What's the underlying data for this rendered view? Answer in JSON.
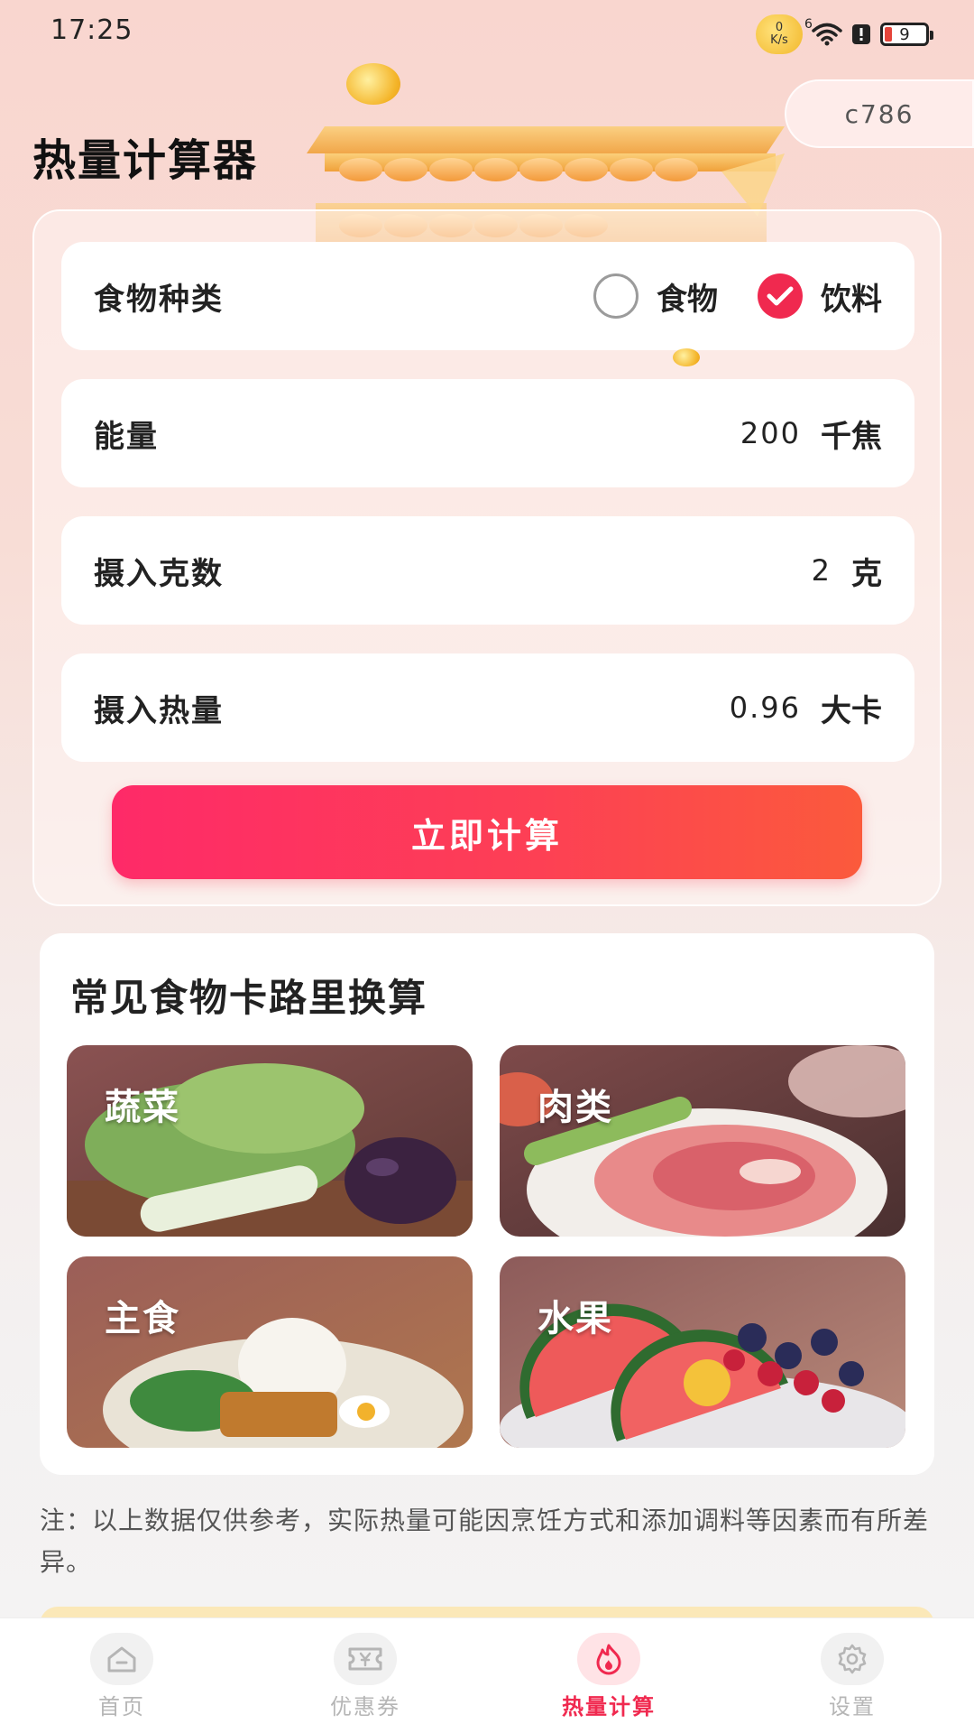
{
  "status_bar": {
    "time": "17:25",
    "net_speed_value": "0",
    "net_speed_unit": "K/s",
    "signal_label": "6",
    "battery_level": "9"
  },
  "header": {
    "title": "热量计算器",
    "user_tag": "c786"
  },
  "calculator": {
    "food_type": {
      "label": "食物种类",
      "options": [
        {
          "label": "食物",
          "checked": false
        },
        {
          "label": "饮料",
          "checked": true
        }
      ]
    },
    "energy": {
      "label": "能量",
      "value": "200",
      "unit": "千焦"
    },
    "grams": {
      "label": "摄入克数",
      "value": "2",
      "unit": "克"
    },
    "calories": {
      "label": "摄入热量",
      "value": "0.96",
      "unit": "大卡"
    },
    "button_label": "立即计算"
  },
  "common_foods": {
    "title": "常见食物卡路里换算",
    "items": [
      {
        "label": "蔬菜",
        "icon": "vegetables-image"
      },
      {
        "label": "肉类",
        "icon": "meat-image"
      },
      {
        "label": "主食",
        "icon": "staple-food-image"
      },
      {
        "label": "水果",
        "icon": "fruit-image"
      }
    ]
  },
  "note": "注：以上数据仅供参考，实际热量可能因烹饪方式和添加调料等因素而有所差异。",
  "nav": {
    "items": [
      {
        "label": "首页",
        "icon": "home-icon",
        "active": false
      },
      {
        "label": "优惠券",
        "icon": "coupon-icon",
        "active": false
      },
      {
        "label": "热量计算",
        "icon": "flame-icon",
        "active": true
      },
      {
        "label": "设置",
        "icon": "gear-icon",
        "active": false
      }
    ]
  },
  "colors": {
    "accent": "#f0294f",
    "button_gradient_start": "#fe2a68",
    "button_gradient_end": "#fb5a3c"
  }
}
